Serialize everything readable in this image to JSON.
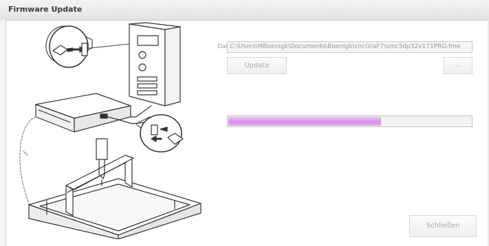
{
  "window": {
    "title": "Firmware Update"
  },
  "file": {
    "label": "Datei",
    "value": "C:\\Users\\MBoenigk\\Documents\\Boenigk\\cncGraF7\\smc5dp32v171PRO.fme"
  },
  "buttons": {
    "update": "Update",
    "browse": "...",
    "close": "Schließen"
  },
  "progress": {
    "value_percent": 63
  },
  "colors": {
    "progress_fill": "#d590e6",
    "title_text": "#3c3c3c",
    "disabled_text": "#a8a8a8"
  }
}
